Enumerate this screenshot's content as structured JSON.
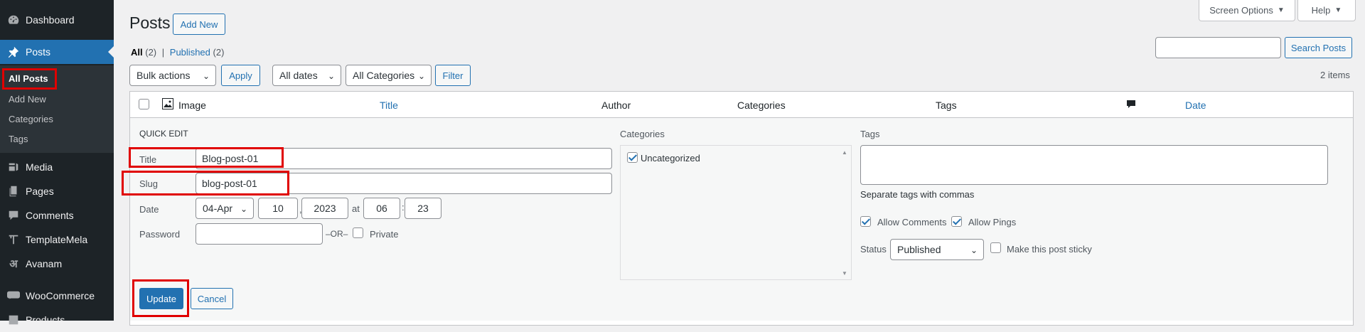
{
  "sidebar": {
    "items": [
      {
        "label": "Dashboard",
        "icon": "dashboard-icon"
      },
      {
        "label": "Posts",
        "icon": "pin-icon"
      },
      {
        "label": "Media",
        "icon": "media-icon"
      },
      {
        "label": "Pages",
        "icon": "pages-icon"
      },
      {
        "label": "Comments",
        "icon": "comments-icon"
      },
      {
        "label": "TemplateMela",
        "icon": "templatemela-icon"
      },
      {
        "label": "Avanam",
        "icon": "avanam-icon"
      },
      {
        "label": "WooCommerce",
        "icon": "woocommerce-icon"
      },
      {
        "label": "Products",
        "icon": "products-icon"
      }
    ],
    "submenu": [
      "All Posts",
      "Add New",
      "Categories",
      "Tags"
    ]
  },
  "topbar": {
    "screen_options": "Screen Options",
    "help": "Help"
  },
  "header": {
    "title": "Posts",
    "add_new": "Add New"
  },
  "views": {
    "all": "All",
    "all_count": "(2)",
    "sep": "|",
    "published": "Published",
    "published_count": "(2)"
  },
  "search": {
    "value": "",
    "button": "Search Posts"
  },
  "filters": {
    "bulk": "Bulk actions",
    "apply": "Apply",
    "dates": "All dates",
    "categories": "All Categories",
    "filter": "Filter",
    "items_count": "2 items"
  },
  "columns": {
    "image": "Image",
    "title": "Title",
    "author": "Author",
    "categories": "Categories",
    "tags": "Tags",
    "date": "Date"
  },
  "quick_edit": {
    "heading": "QUICK EDIT",
    "title_label": "Title",
    "title_value": "Blog-post-01",
    "slug_label": "Slug",
    "slug_value": "blog-post-01",
    "date_label": "Date",
    "month": "04-Apr",
    "day": "10",
    "comma": ",",
    "year": "2023",
    "at": "at",
    "hour": "06",
    "colon": ":",
    "minute": "23",
    "password_label": "Password",
    "password_value": "",
    "or": "–OR–",
    "private": "Private",
    "categories_heading": "Categories",
    "category_item": "Uncategorized",
    "tags_heading": "Tags",
    "tags_hint": "Separate tags with commas",
    "allow_comments": "Allow Comments",
    "allow_pings": "Allow Pings",
    "status_label": "Status",
    "status_value": "Published",
    "sticky": "Make this post sticky",
    "update": "Update",
    "cancel": "Cancel"
  },
  "colors": {
    "accent": "#2271b1",
    "sidebar": "#1d2327",
    "highlight": "#e00000"
  }
}
